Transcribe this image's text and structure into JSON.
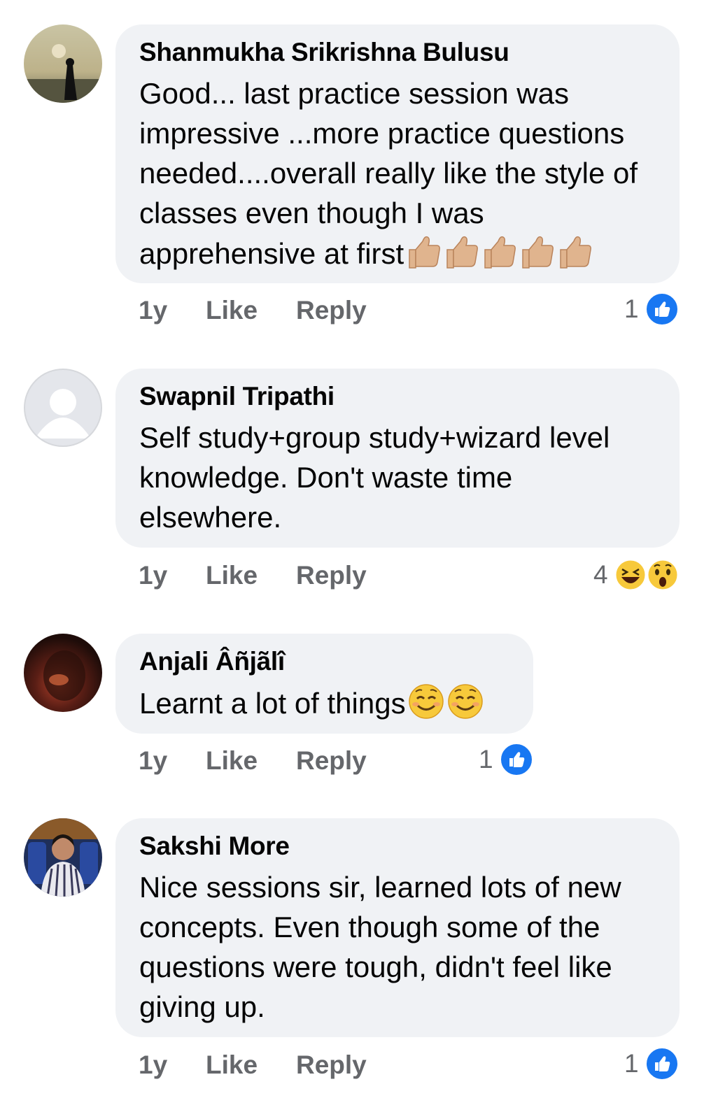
{
  "comments": [
    {
      "author": "Shanmukha Srikrishna Bulusu",
      "text": "Good... last practice session was impressive ...more practice questions needed....overall really like the style of classes even though I was apprehensive at first",
      "trailing_emoji": "thumbs-up x5",
      "time": "1y",
      "like_label": "Like",
      "reply_label": "Reply",
      "reaction_count": "1",
      "reactions": [
        "like"
      ]
    },
    {
      "author": "Swapnil Tripathi",
      "text": "Self study+group study+wizard level knowledge. Don't waste time elsewhere.",
      "time": "1y",
      "like_label": "Like",
      "reply_label": "Reply",
      "reaction_count": "4",
      "reactions": [
        "haha",
        "wow"
      ]
    },
    {
      "author": "Anjali Âñjãlî",
      "text": "Learnt a lot of things",
      "trailing_emoji": "smiling-face x2",
      "time": "1y",
      "like_label": "Like",
      "reply_label": "Reply",
      "reaction_count": "1",
      "reactions": [
        "like"
      ]
    },
    {
      "author": "Sakshi More",
      "text": "Nice sessions sir, learned lots of new concepts. Even though some of the questions were tough, didn't feel like giving up.",
      "time": "1y",
      "like_label": "Like",
      "reply_label": "Reply",
      "reaction_count": "1",
      "reactions": [
        "like"
      ]
    }
  ],
  "colors": {
    "bubble": "#f0f2f5",
    "meta_text": "#65676b",
    "like_blue": "#1877f2"
  }
}
